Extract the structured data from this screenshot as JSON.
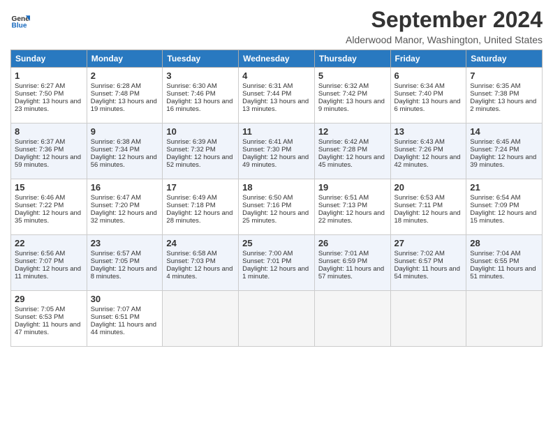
{
  "logo": {
    "line1": "General",
    "line2": "Blue"
  },
  "title": "September 2024",
  "location": "Alderwood Manor, Washington, United States",
  "days_of_week": [
    "Sunday",
    "Monday",
    "Tuesday",
    "Wednesday",
    "Thursday",
    "Friday",
    "Saturday"
  ],
  "weeks": [
    [
      {
        "day": 1,
        "sunrise": "6:27 AM",
        "sunset": "7:50 PM",
        "daylight": "13 hours and 23 minutes."
      },
      {
        "day": 2,
        "sunrise": "6:28 AM",
        "sunset": "7:48 PM",
        "daylight": "13 hours and 19 minutes."
      },
      {
        "day": 3,
        "sunrise": "6:30 AM",
        "sunset": "7:46 PM",
        "daylight": "13 hours and 16 minutes."
      },
      {
        "day": 4,
        "sunrise": "6:31 AM",
        "sunset": "7:44 PM",
        "daylight": "13 hours and 13 minutes."
      },
      {
        "day": 5,
        "sunrise": "6:32 AM",
        "sunset": "7:42 PM",
        "daylight": "13 hours and 9 minutes."
      },
      {
        "day": 6,
        "sunrise": "6:34 AM",
        "sunset": "7:40 PM",
        "daylight": "13 hours and 6 minutes."
      },
      {
        "day": 7,
        "sunrise": "6:35 AM",
        "sunset": "7:38 PM",
        "daylight": "13 hours and 2 minutes."
      }
    ],
    [
      {
        "day": 8,
        "sunrise": "6:37 AM",
        "sunset": "7:36 PM",
        "daylight": "12 hours and 59 minutes."
      },
      {
        "day": 9,
        "sunrise": "6:38 AM",
        "sunset": "7:34 PM",
        "daylight": "12 hours and 56 minutes."
      },
      {
        "day": 10,
        "sunrise": "6:39 AM",
        "sunset": "7:32 PM",
        "daylight": "12 hours and 52 minutes."
      },
      {
        "day": 11,
        "sunrise": "6:41 AM",
        "sunset": "7:30 PM",
        "daylight": "12 hours and 49 minutes."
      },
      {
        "day": 12,
        "sunrise": "6:42 AM",
        "sunset": "7:28 PM",
        "daylight": "12 hours and 45 minutes."
      },
      {
        "day": 13,
        "sunrise": "6:43 AM",
        "sunset": "7:26 PM",
        "daylight": "12 hours and 42 minutes."
      },
      {
        "day": 14,
        "sunrise": "6:45 AM",
        "sunset": "7:24 PM",
        "daylight": "12 hours and 39 minutes."
      }
    ],
    [
      {
        "day": 15,
        "sunrise": "6:46 AM",
        "sunset": "7:22 PM",
        "daylight": "12 hours and 35 minutes."
      },
      {
        "day": 16,
        "sunrise": "6:47 AM",
        "sunset": "7:20 PM",
        "daylight": "12 hours and 32 minutes."
      },
      {
        "day": 17,
        "sunrise": "6:49 AM",
        "sunset": "7:18 PM",
        "daylight": "12 hours and 28 minutes."
      },
      {
        "day": 18,
        "sunrise": "6:50 AM",
        "sunset": "7:16 PM",
        "daylight": "12 hours and 25 minutes."
      },
      {
        "day": 19,
        "sunrise": "6:51 AM",
        "sunset": "7:13 PM",
        "daylight": "12 hours and 22 minutes."
      },
      {
        "day": 20,
        "sunrise": "6:53 AM",
        "sunset": "7:11 PM",
        "daylight": "12 hours and 18 minutes."
      },
      {
        "day": 21,
        "sunrise": "6:54 AM",
        "sunset": "7:09 PM",
        "daylight": "12 hours and 15 minutes."
      }
    ],
    [
      {
        "day": 22,
        "sunrise": "6:56 AM",
        "sunset": "7:07 PM",
        "daylight": "12 hours and 11 minutes."
      },
      {
        "day": 23,
        "sunrise": "6:57 AM",
        "sunset": "7:05 PM",
        "daylight": "12 hours and 8 minutes."
      },
      {
        "day": 24,
        "sunrise": "6:58 AM",
        "sunset": "7:03 PM",
        "daylight": "12 hours and 4 minutes."
      },
      {
        "day": 25,
        "sunrise": "7:00 AM",
        "sunset": "7:01 PM",
        "daylight": "12 hours and 1 minute."
      },
      {
        "day": 26,
        "sunrise": "7:01 AM",
        "sunset": "6:59 PM",
        "daylight": "11 hours and 57 minutes."
      },
      {
        "day": 27,
        "sunrise": "7:02 AM",
        "sunset": "6:57 PM",
        "daylight": "11 hours and 54 minutes."
      },
      {
        "day": 28,
        "sunrise": "7:04 AM",
        "sunset": "6:55 PM",
        "daylight": "11 hours and 51 minutes."
      }
    ],
    [
      {
        "day": 29,
        "sunrise": "7:05 AM",
        "sunset": "6:53 PM",
        "daylight": "11 hours and 47 minutes."
      },
      {
        "day": 30,
        "sunrise": "7:07 AM",
        "sunset": "6:51 PM",
        "daylight": "11 hours and 44 minutes."
      },
      null,
      null,
      null,
      null,
      null
    ]
  ]
}
